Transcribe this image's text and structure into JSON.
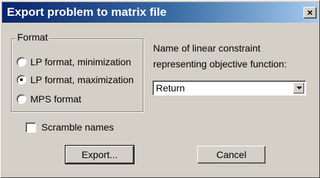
{
  "window": {
    "title": "Export problem to matrix file",
    "close_label": "×"
  },
  "format_group": {
    "legend": "Format",
    "options": [
      {
        "label": "LP format, minimization",
        "checked": false
      },
      {
        "label": "LP format, maximization",
        "checked": true
      },
      {
        "label": "MPS format",
        "checked": false
      }
    ]
  },
  "objective": {
    "label_line1": "Name of linear constraint",
    "label_line2": "representing objective function:",
    "selected_value": "Return"
  },
  "scramble": {
    "label": "Scramble names",
    "checked": false
  },
  "buttons": {
    "export_label": "Export...",
    "cancel_label": "Cancel"
  }
}
